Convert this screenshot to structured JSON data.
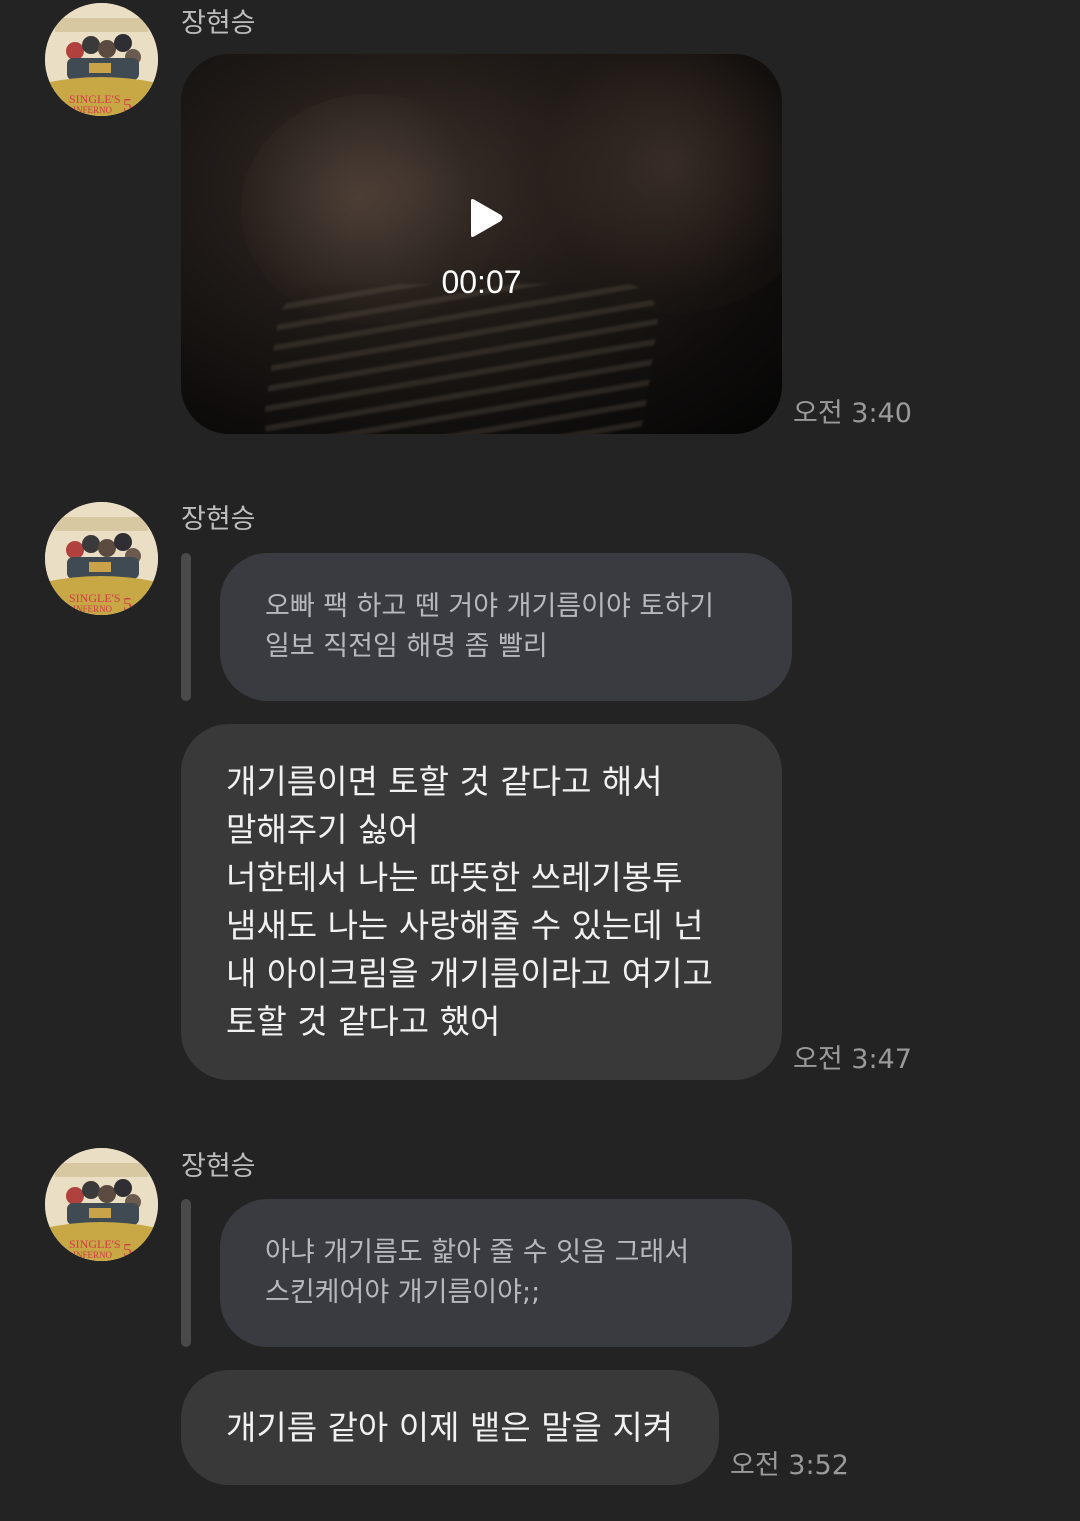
{
  "messages": [
    {
      "sender": "장현승",
      "type": "video",
      "duration": "00:07",
      "time": "오전 3:40"
    },
    {
      "sender": "장현승",
      "type": "reply",
      "quote_lines": [
        "오빠 팩 하고 뗀 거야 개기름이야 토하기",
        "일보 직전임 해명 좀 빨리"
      ],
      "text_lines": [
        "개기름이면 토할 것 같다고 해서",
        "말해주기 싫어",
        "너한테서 나는 따뜻한 쓰레기봉투",
        "냄새도 나는 사랑해줄 수 있는데 넌",
        "내 아이크림을 개기름이라고 여기고",
        "토할 것 같다고 했어"
      ],
      "time": "오전 3:47"
    },
    {
      "sender": "장현승",
      "type": "reply",
      "quote_lines": [
        "아냐 개기름도 핥아 줄 수 잇음 그래서",
        "스킨케어야 개기름이야;;"
      ],
      "text_lines": [
        "개기름 같아 이제 뱉은 말을 지켜"
      ],
      "time": "오전 3:52"
    }
  ],
  "icons": {
    "play": "play-icon",
    "avatar": "avatar-image"
  },
  "colors": {
    "background": "#232323",
    "bubble": "#393939",
    "quote_bubble": "#3a3b40",
    "reply_bar": "#4a4a4a"
  }
}
